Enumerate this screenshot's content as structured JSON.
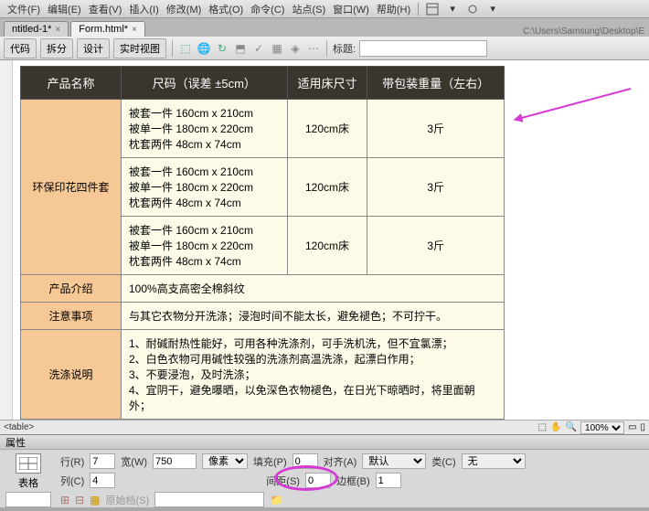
{
  "menu": {
    "file": "文件(F)",
    "edit": "编辑(E)",
    "view": "查看(V)",
    "insert": "插入(I)",
    "modify": "修改(M)",
    "format": "格式(O)",
    "command": "命令(C)",
    "site": "站点(S)",
    "window": "窗口(W)",
    "help": "帮助(H)"
  },
  "tabs": {
    "t1": "ntitled-1*",
    "t2": "Form.html*"
  },
  "path": "C:\\Users\\Samsung\\Desktop\\E",
  "toolbar": {
    "code": "代码",
    "split": "拆分",
    "design": "设计",
    "live": "实时视图",
    "title_label": "标题:",
    "title_value": ""
  },
  "table": {
    "h1": "产品名称",
    "h2": "尺码（误差 ±5cm）",
    "h3": "适用床尺寸",
    "h4": "带包装重量（左右）",
    "name": "环保印花四件套",
    "spec1": "被套一件 160cm x 210cm",
    "spec2": "被单一件 180cm x 220cm",
    "spec3": "枕套两件 48cm x 74cm",
    "bed": "120cm床",
    "weight": "3斤",
    "intro_label": "产品介绍",
    "intro": "100%高支高密全棉斜纹",
    "notice_label": "注意事项",
    "notice": "与其它衣物分开洗涤；浸泡时间不能太长，避免褪色；不可拧干。",
    "wash_label": "洗涤说明",
    "wash1": "1、耐碱耐热性能好，可用各种洗涤剂，可手洗机洗，但不宜氯漂；",
    "wash2": "2、白色衣物可用碱性较强的洗涤剂高温洗涤，起漂白作用；",
    "wash3": "3、不要浸泡，及时洗涤；",
    "wash4": "4、宜阴干，避免曝晒，以免深色衣物褪色，在日光下晾晒时，将里面朝外；"
  },
  "tagbar": {
    "tag": "<table>",
    "zoom": "100%"
  },
  "props": {
    "header": "属性",
    "type": "表格",
    "rows_l": "行(R)",
    "rows": "7",
    "cols_l": "列(C)",
    "cols": "4",
    "width_l": "宽(W)",
    "width": "750",
    "width_unit": "像素",
    "pad_l": "填充(P)",
    "pad": "0",
    "space_l": "间距(S)",
    "space": "0",
    "align_l": "对齐(A)",
    "align": "默认",
    "border_l": "边框(B)",
    "border": "1",
    "class_l": "类(C)",
    "class": "无",
    "src_l": "原始档(S)",
    "src": ""
  }
}
